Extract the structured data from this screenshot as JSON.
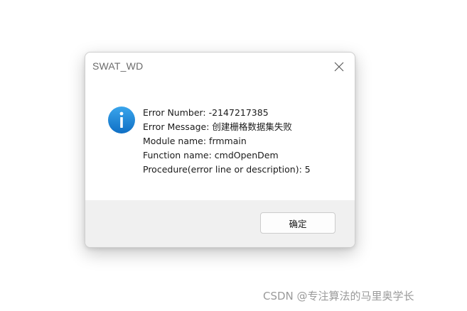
{
  "dialog": {
    "title": "SWAT_WD",
    "close_icon": "close-icon",
    "info_icon": "info-icon",
    "info_icon_color": "#1e88d8",
    "messages": [
      "Error Number:  -2147217385",
      "Error Message:  创建栅格数据集失败",
      "Module name:  frmmain",
      "Function name:  cmdOpenDem",
      "Procedure(error line or description):  5"
    ],
    "ok_label": "确定"
  },
  "watermark": "CSDN @专注算法的马里奥学长"
}
